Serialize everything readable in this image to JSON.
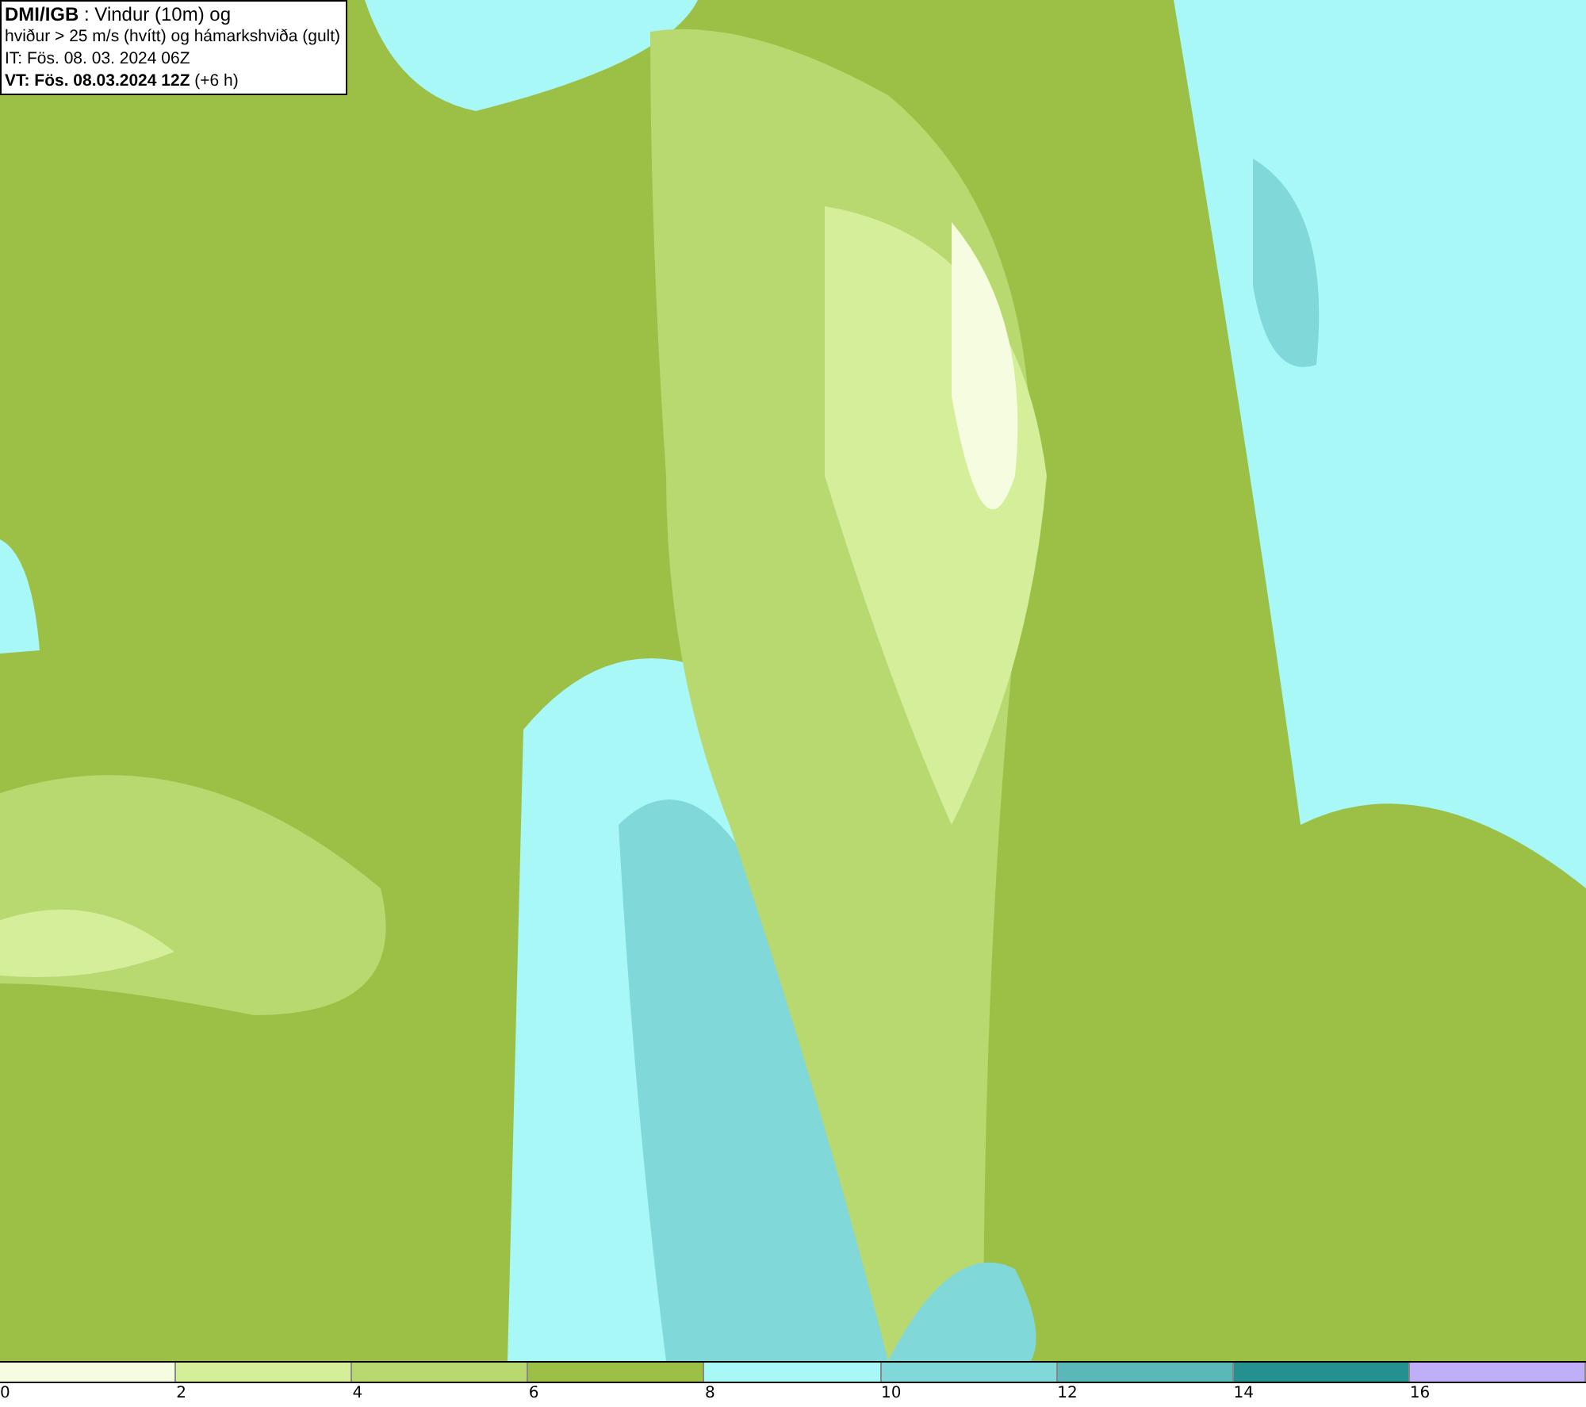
{
  "title_box": {
    "lines": [
      "**DMI/IGB** : Vindur (10m) og",
      "hviður > 25 m/s (hvítt) og hámarkshviða (gult)",
      "IT: Fös. 08. 03. 2024 06Z",
      "**VT: Fös. 08.03.2024 12Z** (+6 h)"
    ]
  },
  "legend": [
    {
      "label": "0",
      "color": "#f5fce0"
    },
    {
      "label": "2",
      "color": "#d4ee9a"
    },
    {
      "label": "4",
      "color": "#b8d870"
    },
    {
      "label": "6",
      "color": "#9cbf45"
    },
    {
      "label": "8",
      "color": "#a8f8f8"
    },
    {
      "label": "10",
      "color": "#80d8d8"
    },
    {
      "label": "12",
      "color": "#5ab8b8"
    },
    {
      "label": "14",
      "color": "#259090"
    },
    {
      "label": "16",
      "color": "#c0aef8"
    }
  ]
}
